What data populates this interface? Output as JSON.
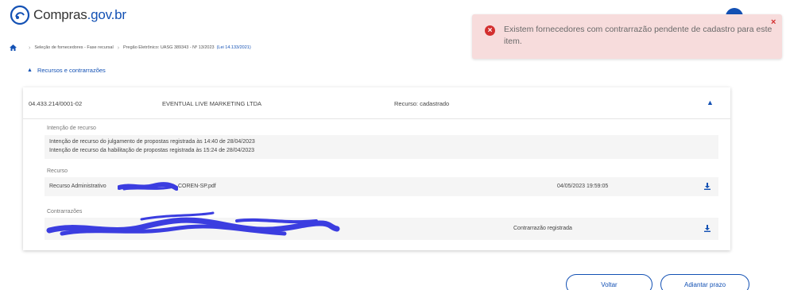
{
  "header": {
    "logo_text": "Compras",
    "logo_domain": ".gov.br"
  },
  "toast": {
    "message": "Existem fornecedores com contrarrazão pendente de cadastro para este item.",
    "close": "×"
  },
  "breadcrumb": {
    "items": [
      "Seleção de fornecedores - Fase recursal",
      "Pregão Eletrônico: UASG 389343 - Nº 13/2023"
    ],
    "law_link": "(Lei 14.133/2021)"
  },
  "section": {
    "toggle_label": "Recursos e contrarrazões"
  },
  "card": {
    "cnpj": "04.433.214/0001-02",
    "company": "EVENTUAL LIVE MARKETING LTDA",
    "status": "Recurso: cadastrado",
    "intencao": {
      "label": "Intenção de recurso",
      "lines": [
        "Intenção de recurso do julgamento de propostas registrada às 14:40 de 28/04/2023",
        "Intenção de recurso da habilitação de propostas registrada às 15:24 de 28/04/2023"
      ]
    },
    "recurso": {
      "label": "Recurso",
      "file_prefix": "Recurso Administrativo",
      "file_suffix": "COREN-SP.pdf",
      "timestamp": "04/05/2023 19:59:05"
    },
    "contrarrazoes": {
      "label": "Contrarrazões",
      "status": "Contrarrazão registrada"
    }
  },
  "actions": {
    "voltar": "Voltar",
    "adiantar": "Adiantar prazo"
  },
  "colors": {
    "primary": "#1351b4",
    "error": "#d32f2f",
    "toast_bg": "#f7dcdc",
    "row_bg": "#f5f5f5",
    "scribble": "#3b3de0"
  },
  "icons": {
    "logo": "compras-logo-icon",
    "home": "home-icon",
    "error": "error-circle-icon",
    "download": "download-icon",
    "chevron": "chevron-up-icon"
  }
}
